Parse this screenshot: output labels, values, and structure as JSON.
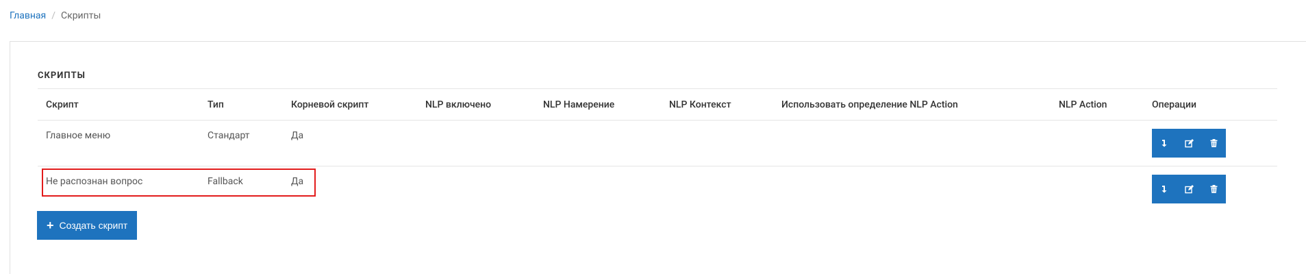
{
  "breadcrumb": {
    "home": "Главная",
    "separator": "/",
    "current": "Скрипты"
  },
  "panel": {
    "title": "СКРИПТЫ"
  },
  "table": {
    "headers": {
      "script": "Скрипт",
      "type": "Тип",
      "root": "Корневой скрипт",
      "nlp_enabled": "NLP включено",
      "nlp_intent": "NLP Намерение",
      "nlp_context": "NLP Контекст",
      "use_nlp_action": "Использовать определение NLP Action",
      "nlp_action": "NLP Action",
      "operations": "Операции"
    },
    "rows": [
      {
        "script": "Главное меню",
        "type": "Стандарт",
        "root": "Да",
        "nlp_enabled": "",
        "nlp_intent": "",
        "nlp_context": "",
        "use_nlp_action": "",
        "nlp_action": ""
      },
      {
        "script": "Не распознан вопрос",
        "type": "Fallback",
        "root": "Да",
        "nlp_enabled": "",
        "nlp_intent": "",
        "nlp_context": "",
        "use_nlp_action": "",
        "nlp_action": ""
      }
    ],
    "operation_icons": [
      "arrow-down-icon",
      "edit-icon",
      "trash-icon"
    ]
  },
  "create_button": {
    "label": "Создать скрипт",
    "icon": "plus-icon"
  },
  "colors": {
    "primary": "#1e73be",
    "highlight": "#e21b1b",
    "border": "#e5e5e5"
  }
}
